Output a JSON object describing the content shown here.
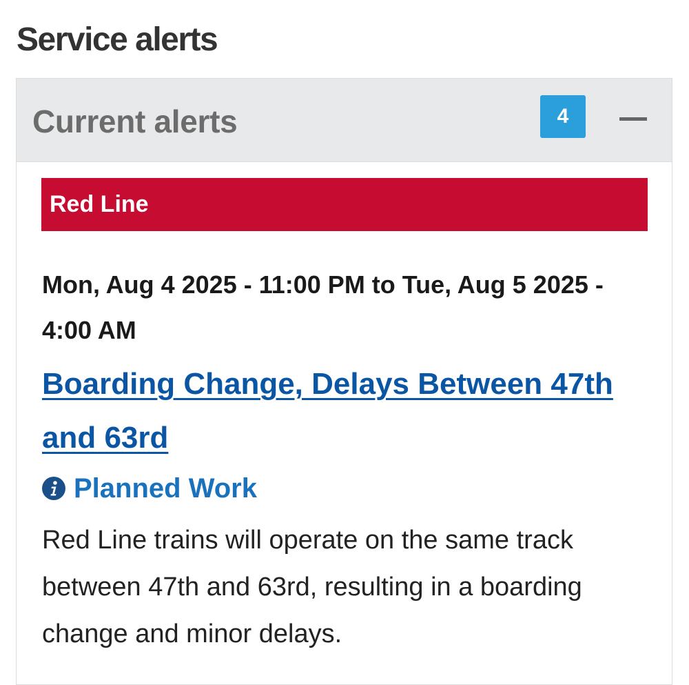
{
  "page": {
    "title": "Service alerts"
  },
  "panel": {
    "title": "Current alerts",
    "count": "4",
    "toggle_icon": "minus-icon"
  },
  "alert": {
    "line": "Red Line",
    "line_color": "#c60c30",
    "dates": "Mon, Aug 4 2025 - 11:00 PM to Tue, Aug 5 2025 - 4:00 AM",
    "headline": "Boarding Change, Delays Between 47th and 63rd",
    "type_icon": "info-icon",
    "type": "Planned Work",
    "description": "Red Line trains will operate on the same track between 47th and 63rd, resulting in a boarding change and minor delays."
  },
  "colors": {
    "badge": "#2b9fdc",
    "link": "#0b56a4",
    "type_label": "#1a72bd",
    "header_bg": "#e8e9ea"
  }
}
